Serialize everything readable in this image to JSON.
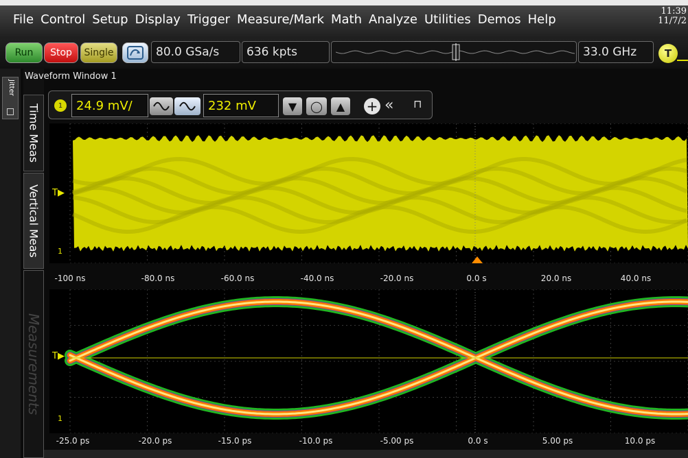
{
  "menu": {
    "items": [
      "File",
      "Control",
      "Setup",
      "Display",
      "Trigger",
      "Measure/Mark",
      "Math",
      "Analyze",
      "Utilities",
      "Demos",
      "Help"
    ],
    "clock_time": "11:39",
    "clock_date": "11/7/2"
  },
  "toolbar": {
    "run_label": "Run",
    "stop_label": "Stop",
    "single_label": "Single",
    "sample_rate": "80.0 GSa/s",
    "memory_depth": "636 kpts",
    "bandwidth": "33.0 GHz",
    "trigger_label": "T"
  },
  "side_tabs": {
    "jitter": "Jitter",
    "time_meas": "Time Meas",
    "vertical_meas": "Vertical Meas",
    "measurements": "Measurements"
  },
  "waveform_window": {
    "title": "Waveform Window 1",
    "channel_number": "1",
    "vertical_scale": "24.9 mV/",
    "offset": "232 mV",
    "channel_color": "#d4d400"
  },
  "colors": {
    "grid": "#3a3a3a",
    "trace": "#d4d400",
    "eye_outer": "#22b522",
    "eye_mid": "#ff7a00",
    "eye_inner": "#ffe680"
  },
  "plot1": {
    "trigger_marker": "T",
    "ground_marker": "1",
    "x_labels": [
      "-100 ns",
      "-80.0 ns",
      "-60.0 ns",
      "-40.0 ns",
      "-20.0 ns",
      "0.0 s",
      "20.0 ns",
      "40.0 ns"
    ]
  },
  "plot2": {
    "trigger_marker": "T",
    "ground_marker": "1",
    "x_labels": [
      "-25.0 ps",
      "-20.0 ps",
      "-15.0 ps",
      "-10.0 ps",
      "-5.00 ps",
      "0.0 s",
      "5.00 ps",
      "10.0 ps"
    ]
  }
}
